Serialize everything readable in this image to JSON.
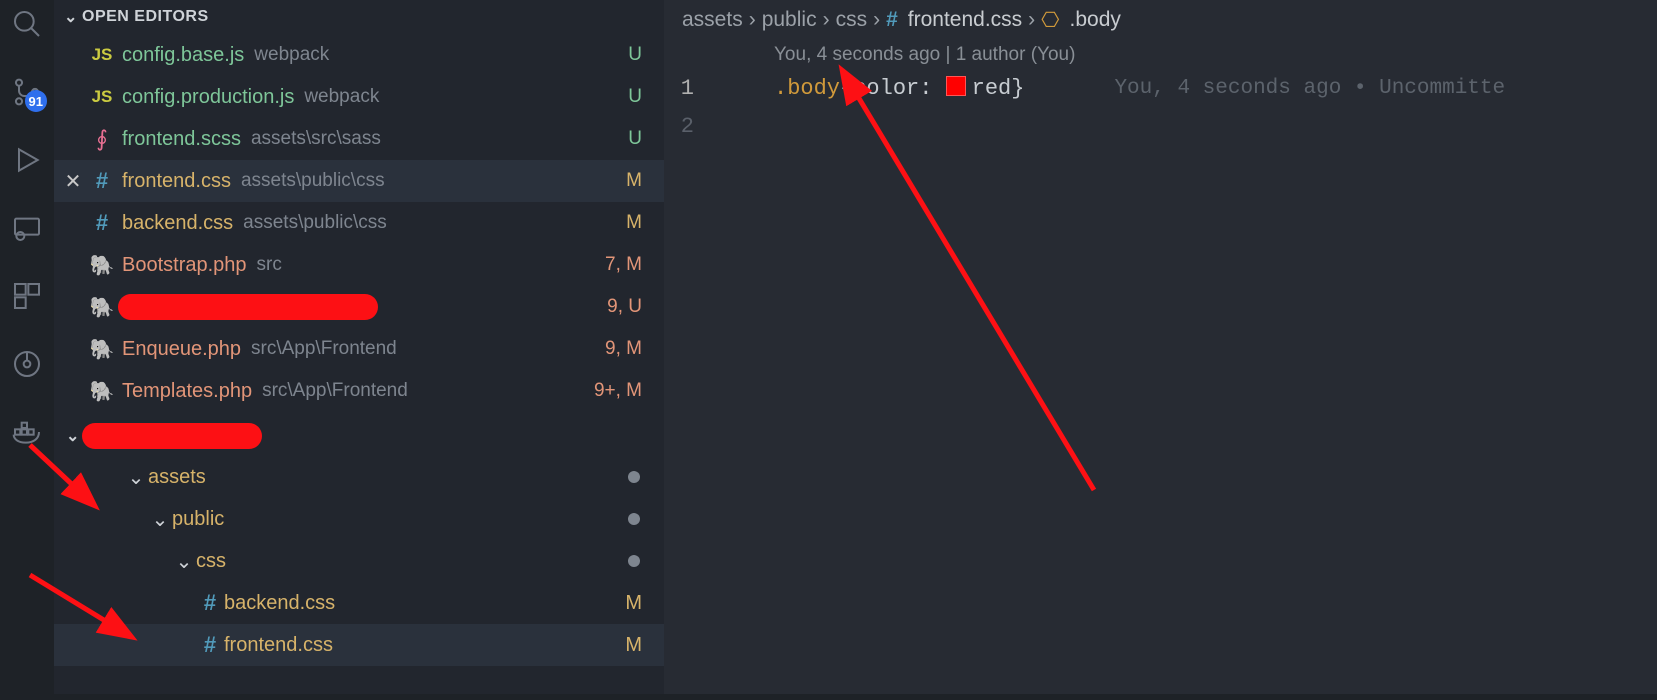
{
  "activity": {
    "badge": "91"
  },
  "sidebar": {
    "open_editors_title": "OPEN EDITORS",
    "editors": [
      {
        "icon": "js",
        "name": "config.base.js",
        "path": "webpack",
        "status": "U",
        "color": "green"
      },
      {
        "icon": "js",
        "name": "config.production.js",
        "path": "webpack",
        "status": "U",
        "color": "green"
      },
      {
        "icon": "sass",
        "name": "frontend.scss",
        "path": "assets\\src\\sass",
        "status": "U",
        "color": "green"
      },
      {
        "icon": "hash",
        "name": "frontend.css",
        "path": "assets\\public\\css",
        "status": "M",
        "color": "yellow",
        "active": true
      },
      {
        "icon": "hash",
        "name": "backend.css",
        "path": "assets\\public\\css",
        "status": "M",
        "color": "yellow"
      },
      {
        "icon": "php",
        "name": "Bootstrap.php",
        "path": "src",
        "status": "7, M",
        "color": "salmon"
      },
      {
        "icon": "php",
        "name": "",
        "path": "",
        "status": "9, U",
        "color": "salmon",
        "redact": true
      },
      {
        "icon": "php",
        "name": "Enqueue.php",
        "path": "src\\App\\Frontend",
        "status": "9, M",
        "color": "salmon"
      },
      {
        "icon": "php",
        "name": "Templates.php",
        "path": "src\\App\\Frontend",
        "status": "9+, M",
        "color": "salmon"
      }
    ],
    "tree": {
      "assets": "assets",
      "public": "public",
      "css": "css",
      "backend": "backend.css",
      "frontend": "frontend.css",
      "backend_status": "M",
      "frontend_status": "M"
    }
  },
  "breadcrumb": {
    "p1": "assets",
    "p2": "public",
    "p3": "css",
    "p4": "frontend.css",
    "p5": ".body"
  },
  "code": {
    "lens": "You, 4 seconds ago | 1 author (You)",
    "ln1": "1",
    "ln2": "2",
    "selector": ".body",
    "brace_l": "{",
    "prop": "color",
    "colon": ":",
    "value": "red",
    "brace_r": "}",
    "blame": "You, 4 seconds ago • Uncommitte"
  }
}
